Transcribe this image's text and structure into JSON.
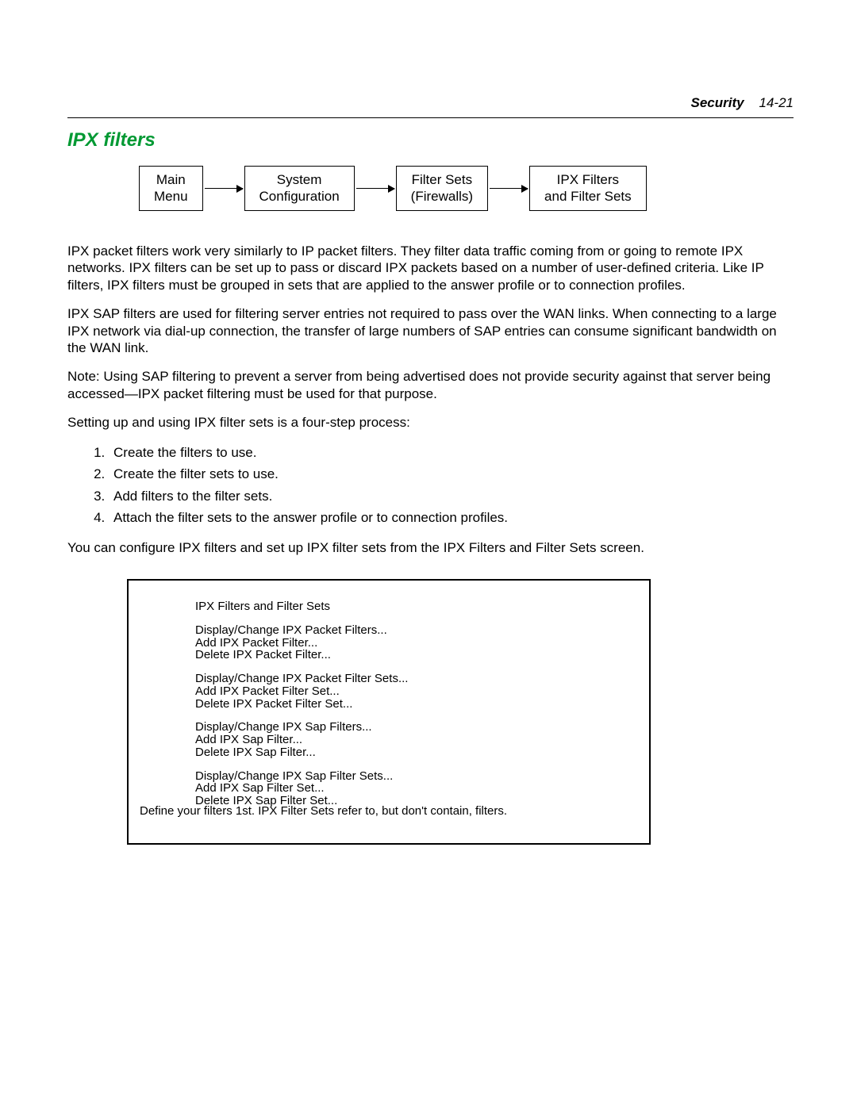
{
  "header": {
    "section": "Security",
    "page": "14-21"
  },
  "title": "IPX filters",
  "breadcrumb": [
    "Main\nMenu",
    "System\nConfiguration",
    "Filter Sets\n(Firewalls)",
    "IPX Filters\nand Filter Sets"
  ],
  "para1": "IPX packet filters work very similarly to IP packet filters. They filter data traffic coming from or going to remote IPX networks. IPX filters can be set up to pass or discard IPX packets based on a number of user-defined criteria. Like IP filters, IPX filters must be grouped in sets that are applied to the answer profile or to connection profiles.",
  "para2": "IPX SAP filters are used for filtering server entries not required to pass over the WAN links. When connecting to a large IPX network via dial-up connection, the transfer of large numbers of SAP entries can consume significant bandwidth on the WAN link.",
  "para3": "Note:  Using SAP filtering to prevent a server from being advertised does not provide security against that server being accessed—IPX packet filtering must be used for that purpose.",
  "para4": "Setting up and using IPX filter sets is a four-step process:",
  "steps": [
    "Create the filters to use.",
    "Create the filter sets to use.",
    "Add filters to the filter sets.",
    "Attach the filter sets to the answer profile or to connection profiles."
  ],
  "para5": "You can configure IPX filters and set up IPX filter sets from the IPX Filters and Filter Sets screen.",
  "screen": {
    "title": "IPX Filters and Filter Sets",
    "groups": [
      [
        "Display/Change IPX Packet Filters...",
        "Add IPX Packet Filter...",
        "Delete IPX Packet Filter..."
      ],
      [
        "Display/Change IPX Packet Filter Sets...",
        "Add IPX Packet Filter Set...",
        "Delete IPX Packet Filter Set..."
      ],
      [
        "Display/Change IPX Sap Filters...",
        "Add IPX Sap Filter...",
        "Delete IPX Sap Filter..."
      ],
      [
        "Display/Change IPX Sap Filter Sets...",
        "Add IPX Sap Filter Set...",
        "Delete IPX Sap Filter Set..."
      ]
    ],
    "hint": "Define your filters 1st. IPX Filter Sets refer to, but don't contain, filters."
  }
}
